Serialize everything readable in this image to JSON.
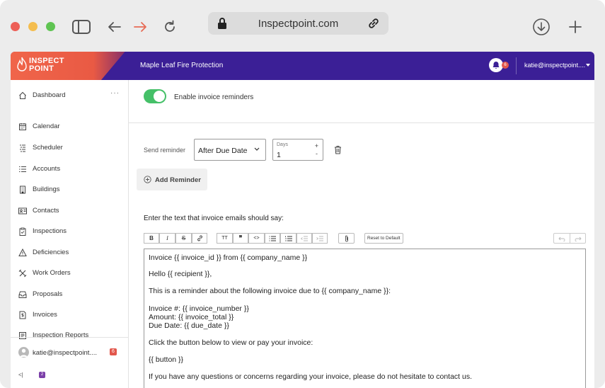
{
  "browser": {
    "url": "Inspectpoint.com"
  },
  "header": {
    "logo_line1": "INSPECT",
    "logo_line2": "POINT",
    "company": "Maple Leaf Fire Protection",
    "notification_count": "6",
    "user_email": "katie@inspectpoint...."
  },
  "sidebar": {
    "items": [
      {
        "label": "Dashboard",
        "icon": "home-icon"
      },
      {
        "label": "Calendar",
        "icon": "calendar-icon"
      },
      {
        "label": "Scheduler",
        "icon": "scheduler-icon"
      },
      {
        "label": "Accounts",
        "icon": "list-icon"
      },
      {
        "label": "Buildings",
        "icon": "building-icon"
      },
      {
        "label": "Contacts",
        "icon": "contact-card-icon"
      },
      {
        "label": "Inspections",
        "icon": "clipboard-icon"
      },
      {
        "label": "Deficiencies",
        "icon": "warning-icon"
      },
      {
        "label": "Work Orders",
        "icon": "tools-icon"
      },
      {
        "label": "Proposals",
        "icon": "inbox-icon"
      },
      {
        "label": "Invoices",
        "icon": "invoice-icon"
      },
      {
        "label": "Inspection Reports",
        "icon": "report-icon"
      }
    ],
    "more": "···",
    "user_email": "katie@inspectpoint....",
    "user_badge": "6",
    "footer_text": "<|",
    "footer_badge": "2"
  },
  "main": {
    "toggle_label": "Enable invoice reminders",
    "toggle_on": true,
    "send_reminder_label": "Send reminder",
    "timing_select": "After Due Date",
    "days_label": "Days",
    "days_value": "1",
    "days_plus": "+",
    "days_minus": "-",
    "add_reminder_label": "Add Reminder",
    "editor_title": "Enter the text that invoice emails should say:",
    "reset_label": "Reset to Default",
    "editor_lines": [
      "Invoice {{ invoice_id }} from {{ company_name }}",
      "Hello {{ recipient }},",
      "This is a reminder about the following invoice due to {{ company_name }}:",
      "Invoice #: {{ invoice_number }}",
      "Amount: {{ invoice_total }}",
      "Due Date: {{ due_date }}",
      "Click the button below to view or pay your invoice:",
      "{{ button }}",
      "If you have any questions or concerns regarding your invoice, please do not hesitate to contact us."
    ]
  },
  "colors": {
    "header": "#3b1f96",
    "logo": "#f0654a",
    "toggle": "#45c068",
    "badge": "#e2574c"
  }
}
